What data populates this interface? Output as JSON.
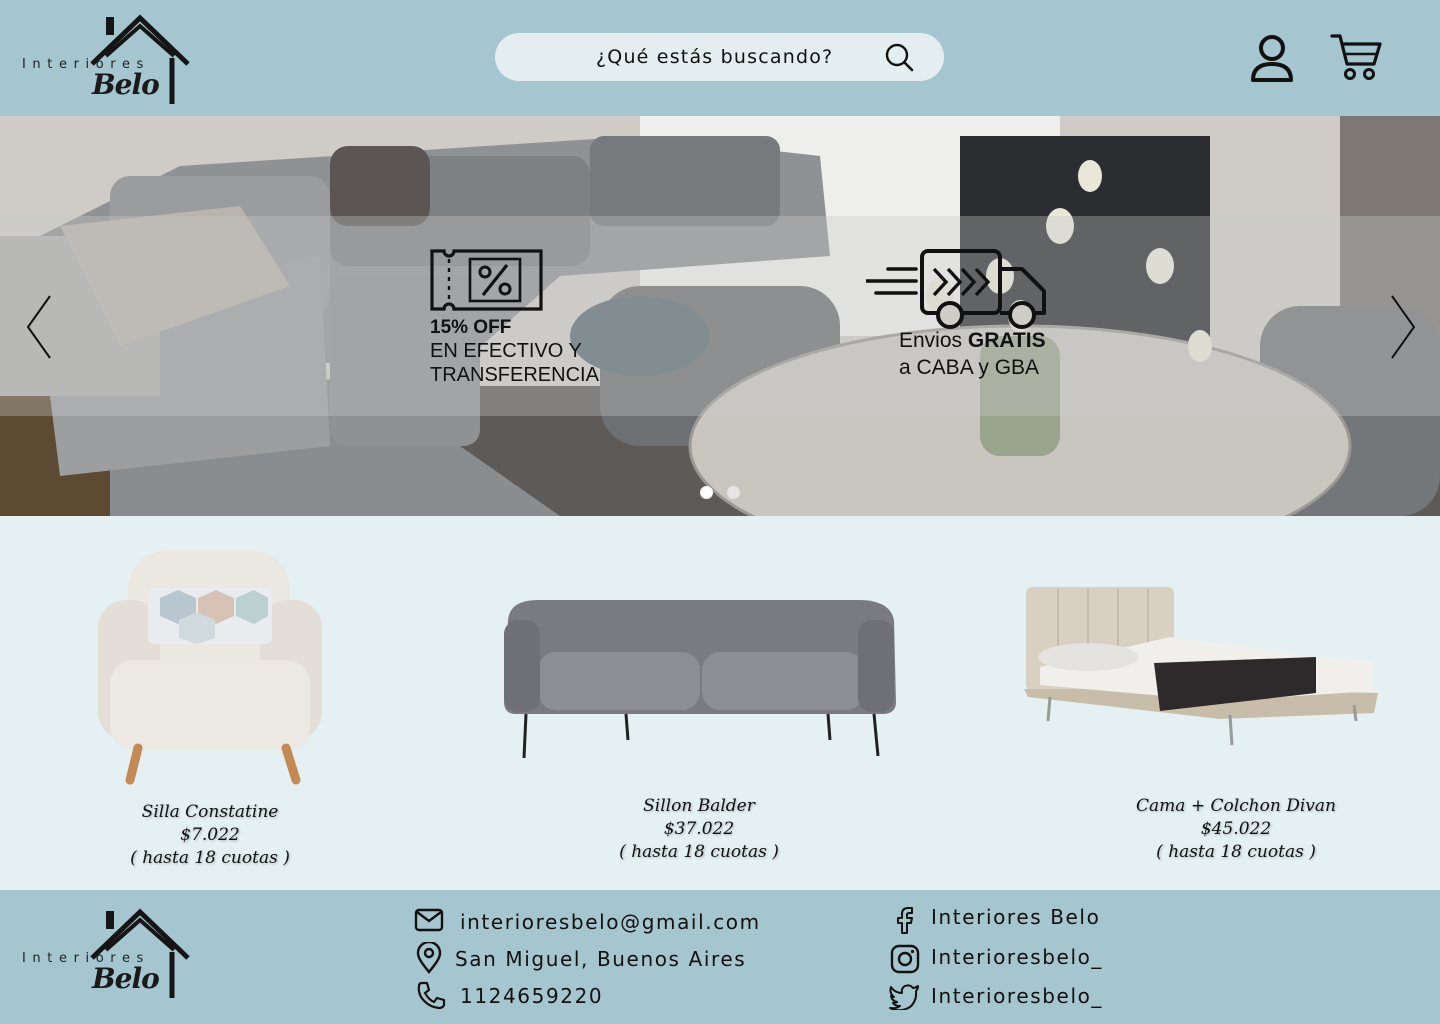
{
  "brand": {
    "top": "Interiores",
    "main": "Belo"
  },
  "search": {
    "placeholder": "¿Qué estás buscando?"
  },
  "header_icons": {
    "user": "user-icon",
    "cart": "cart-icon",
    "search": "search-icon"
  },
  "hero": {
    "promo_cash": {
      "icon": "discount-ticket-icon",
      "percent_line": "15% OFF",
      "line2": "EN EFECTIVO Y",
      "line3": "TRANSFERENCIA"
    },
    "promo_shipping": {
      "icon": "fast-truck-icon",
      "line1_prefix": "Envios ",
      "line1_bold": "GRATIS",
      "line2": "a CABA y GBA"
    },
    "slides_total": 2,
    "active_slide": 1
  },
  "products": [
    {
      "name": "Silla Constatine",
      "price": "$7.022",
      "installments": "( hasta 18 cuotas )"
    },
    {
      "name": "Sillon Balder",
      "price": "$37.022",
      "installments": "( hasta 18 cuotas )"
    },
    {
      "name": "Cama + Colchon Divan",
      "price": "$45.022",
      "installments": "( hasta 18 cuotas )"
    }
  ],
  "footer": {
    "email": "interioresbelo@gmail.com",
    "location": "San Miguel, Buenos Aires",
    "phone": "1124659220",
    "facebook": "Interiores Belo",
    "instagram": "Interioresbelo_",
    "twitter": "Interioresbelo_"
  },
  "colors": {
    "header_bg": "#a5c6cf",
    "page_bg": "#e4f0f2",
    "search_bg": "#e4eef0"
  }
}
